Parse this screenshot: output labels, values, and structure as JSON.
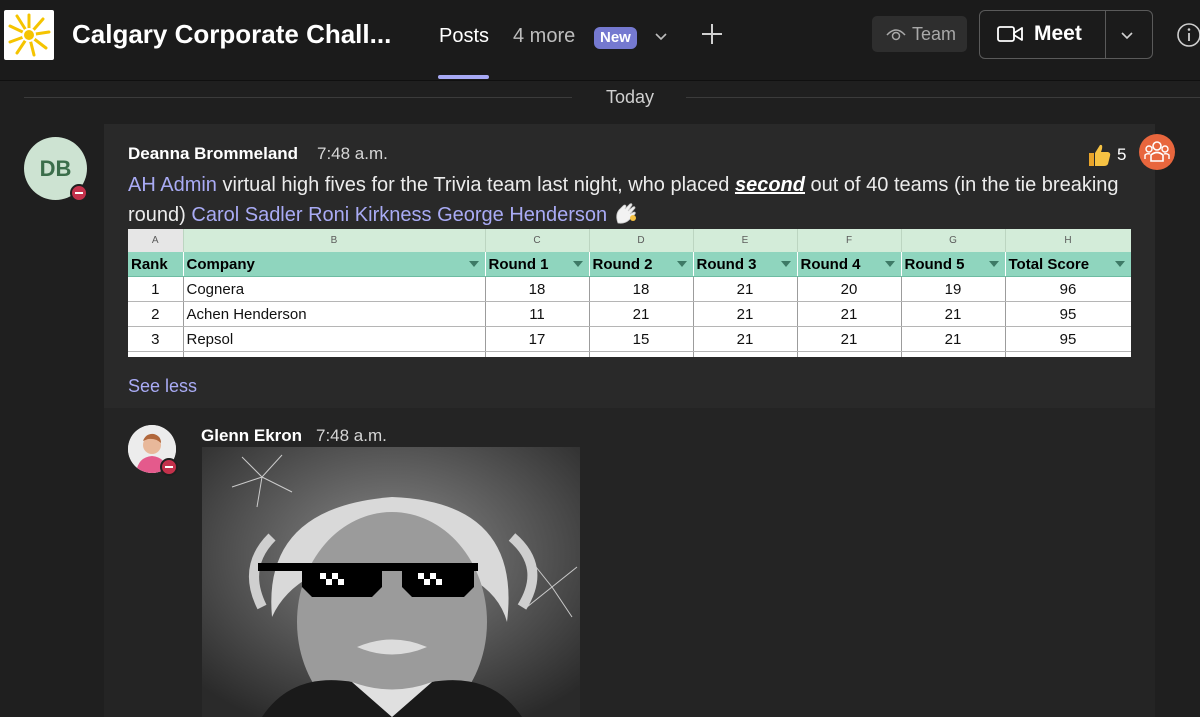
{
  "header": {
    "team_title": "Calgary Corporate Chall...",
    "tabs": {
      "posts": "Posts",
      "more": "4 more",
      "new_badge": "New"
    },
    "team_button": "Team",
    "meet_button": "Meet",
    "accent_color": "#a7a9f5"
  },
  "feed": {
    "date_divider": "Today",
    "message": {
      "avatar_initials": "DB",
      "author": "Deanna Brommeland",
      "time": "7:48 a.m.",
      "reaction_count": "5",
      "text": {
        "mention_admin": "AH Admin",
        "part1": " virtual high fives for the Trivia team last night, who placed ",
        "emphasis": "second",
        "part2": " out of 40 teams (in the tie breaking round) ",
        "mention_1": "Carol Sadler",
        "mention_2": "Roni Kirkness",
        "mention_3": "George Henderson"
      },
      "see_less": "See less"
    },
    "spreadsheet": {
      "column_letters": [
        "A",
        "B",
        "C",
        "D",
        "E",
        "F",
        "G",
        "H"
      ],
      "headers": [
        "Rank",
        "Company",
        "Round 1",
        "Round 2",
        "Round 3",
        "Round 4",
        "Round 5",
        "Total Score"
      ],
      "rows": [
        [
          "1",
          "Cognera",
          "18",
          "18",
          "21",
          "20",
          "19",
          "96"
        ],
        [
          "2",
          "Achen Henderson",
          "11",
          "21",
          "21",
          "21",
          "21",
          "95"
        ],
        [
          "3",
          "Repsol",
          "17",
          "15",
          "21",
          "21",
          "21",
          "95"
        ]
      ]
    },
    "reply": {
      "author": "Glenn Ekron",
      "time": "7:48 a.m."
    }
  }
}
